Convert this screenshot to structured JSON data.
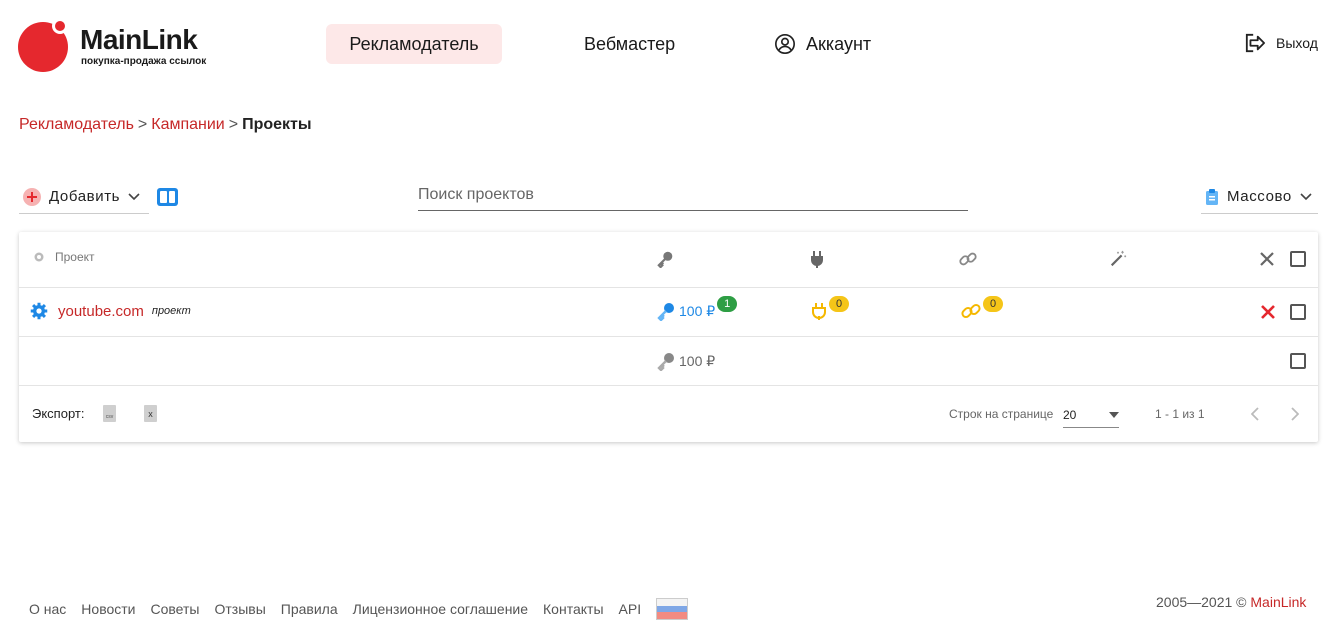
{
  "header": {
    "logo_name": "MainLink",
    "logo_tagline": "покупка-продажа ссылок",
    "nav": [
      {
        "label": "Рекламодатель"
      },
      {
        "label": "Вебмастер"
      },
      {
        "label": "Аккаунт"
      }
    ],
    "logout_label": "Выход"
  },
  "breadcrumb": {
    "items": [
      "Рекламодатель",
      "Кампании",
      "Проекты"
    ],
    "separator": ">"
  },
  "toolbar": {
    "add_label": "Добавить",
    "search_placeholder": "Поиск проектов",
    "mass_label": "Массово"
  },
  "table": {
    "header_project": "Проект",
    "rows": [
      {
        "project": "youtube.com",
        "tag": "проект",
        "price": "100 ₽",
        "price_badge": "1",
        "plug_badge": "0",
        "link_badge": "0"
      },
      {
        "price": "100 ₽"
      }
    ],
    "footer": {
      "export_label": "Экспорт:",
      "rows_per_page_label": "Строк на странице",
      "rows_per_page_value": "20",
      "range": "1 - 1 из 1"
    }
  },
  "footer": {
    "links": [
      "О нас",
      "Новости",
      "Советы",
      "Отзывы",
      "Правила",
      "Лицензионное соглашение",
      "Контакты",
      "API"
    ],
    "copyright_years": "2005—2021 ©",
    "copyright_brand": "MainLink"
  },
  "colors": {
    "brand_red": "#e5282e",
    "link_red": "#c62828",
    "accent_blue": "#1e88e5",
    "badge_green": "#2e9e44",
    "badge_yellow": "#f5c518"
  }
}
